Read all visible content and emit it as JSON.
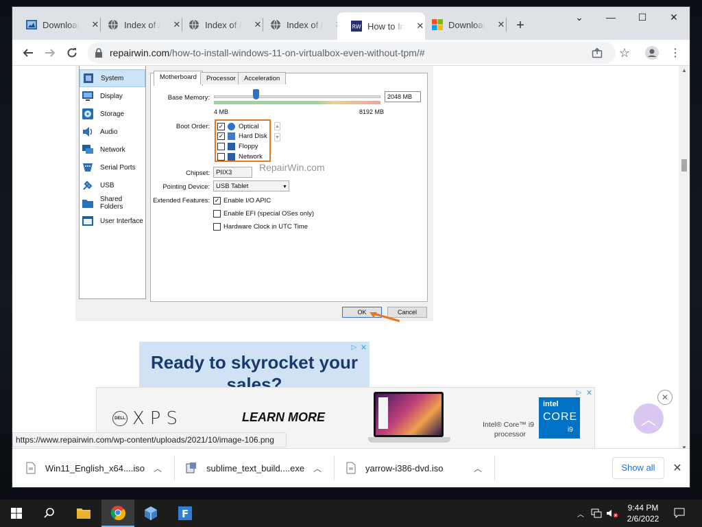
{
  "browser": {
    "tabs": [
      {
        "title": "Downloads",
        "icon": "download-page-icon",
        "active": false
      },
      {
        "title": "Index of /",
        "icon": "globe-icon",
        "active": false
      },
      {
        "title": "Index of /",
        "icon": "globe-icon",
        "active": false
      },
      {
        "title": "Index of /",
        "icon": "globe-icon",
        "active": false
      },
      {
        "title": "How to Install",
        "icon": "repairwin-icon",
        "active": true
      },
      {
        "title": "Downloads",
        "icon": "windows-logo-icon",
        "active": false
      }
    ],
    "new_tab": "+",
    "url_host": "repairwin.com",
    "url_path": "/how-to-install-windows-11-on-virtualbox-even-without-tpm/#",
    "status_url": "https://www.repairwin.com/wp-content/uploads/2021/10/image-106.png"
  },
  "vbox": {
    "sidebar": [
      "System",
      "Display",
      "Storage",
      "Audio",
      "Network",
      "Serial Ports",
      "USB",
      "Shared Folders",
      "User Interface"
    ],
    "tabs": [
      "Motherboard",
      "Processor",
      "Acceleration"
    ],
    "base_memory_label": "Base Memory:",
    "base_memory_value": "2048 MB",
    "mem_min": "4 MB",
    "mem_max": "8192 MB",
    "boot_order_label": "Boot Order:",
    "boot_items": [
      {
        "label": "Optical",
        "checked": true
      },
      {
        "label": "Hard Disk",
        "checked": true
      },
      {
        "label": "Floppy",
        "checked": false
      },
      {
        "label": "Network",
        "checked": false
      }
    ],
    "chipset_label": "Chipset:",
    "chipset_value": "PIIX3",
    "watermark": "RepairWin.com",
    "pointing_label": "Pointing Device:",
    "pointing_value": "USB Tablet",
    "ext_label": "Extended Features:",
    "features": [
      {
        "label": "Enable I/O APIC",
        "checked": true
      },
      {
        "label": "Enable EFI (special OSes only)",
        "checked": false
      },
      {
        "label": "Hardware Clock in UTC Time",
        "checked": false
      }
    ],
    "ok": "OK",
    "cancel": "Cancel"
  },
  "ads": {
    "headline": "Ready to skyrocket your sales?",
    "xps_brand": "DELL",
    "xps_text": "XPS",
    "learn_more": "LEARN MORE",
    "intel_line1": "Intel® Core™ i9",
    "intel_line2": "processor",
    "intel_badge_top": "intel",
    "intel_badge_mid": "CORE",
    "intel_badge_bot": "i9"
  },
  "downloads": [
    {
      "name": "Win11_English_x64....iso"
    },
    {
      "name": "sublime_text_build....exe"
    },
    {
      "name": "yarrow-i386-dvd.iso"
    }
  ],
  "show_all": "Show all",
  "taskbar": {
    "time": "9:44 PM",
    "date": "2/6/2022"
  },
  "colors": {
    "accent_orange": "#e87722",
    "link_blue": "#1a73e8",
    "ad_blue": "#1b3a6b"
  }
}
